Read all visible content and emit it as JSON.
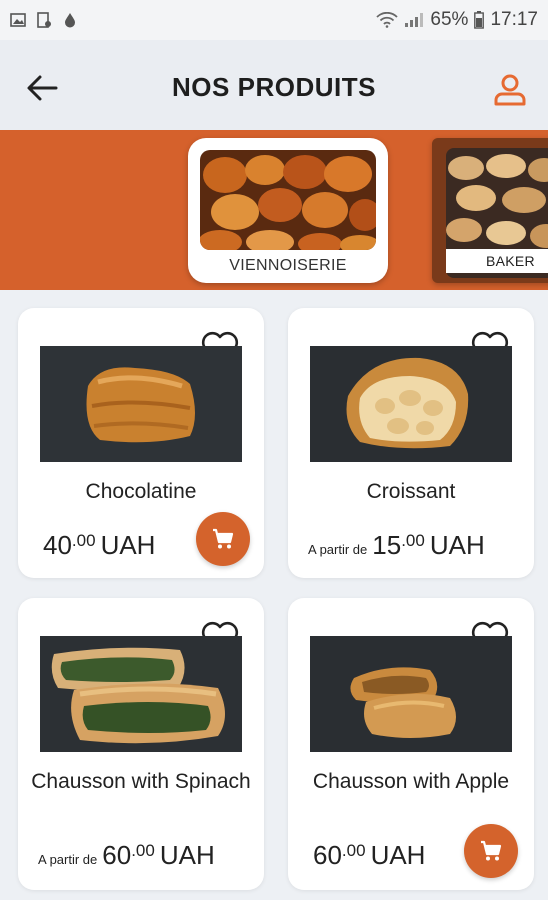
{
  "status_bar": {
    "battery": "65%",
    "time": "17:17"
  },
  "header": {
    "title": "NOS PRODUITS"
  },
  "categories": [
    {
      "label": "VIENNOISERIE"
    },
    {
      "label": "BAKER"
    }
  ],
  "products": [
    {
      "name": "Chocolatine",
      "prefix": "",
      "price_int": "40",
      "price_dec": ".00",
      "currency": "UAH"
    },
    {
      "name": "Croissant",
      "prefix": "A partir de",
      "price_int": "15",
      "price_dec": ".00",
      "currency": "UAH"
    },
    {
      "name": "Chausson with Spinach",
      "prefix": "A partir de",
      "price_int": "60",
      "price_dec": ".00",
      "currency": "UAH"
    },
    {
      "name": "Chausson with Apple",
      "prefix": "",
      "price_int": "60",
      "price_dec": ".00",
      "currency": "UAH"
    }
  ],
  "colors": {
    "accent": "#d4632c",
    "banner": "#d5612c"
  }
}
